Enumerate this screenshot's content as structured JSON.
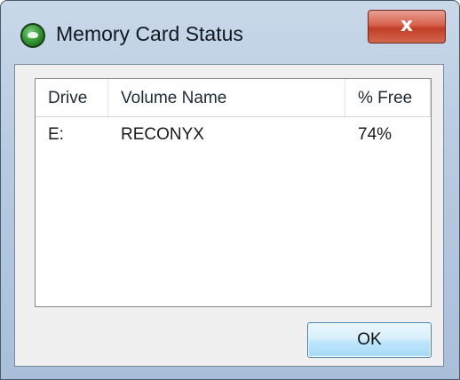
{
  "window": {
    "title": "Memory Card Status",
    "app_icon": "app-icon",
    "close_label": "x"
  },
  "list": {
    "columns": [
      "Drive",
      "Volume Name",
      "% Free"
    ],
    "rows": [
      {
        "drive": "E:",
        "volume_name": "RECONYX",
        "free": "74%"
      }
    ]
  },
  "buttons": {
    "ok_label": "OK"
  },
  "colors": {
    "close_button": "#c13d26",
    "ok_button_border": "#3c7fb1",
    "client_background": "#f0f0f0"
  }
}
